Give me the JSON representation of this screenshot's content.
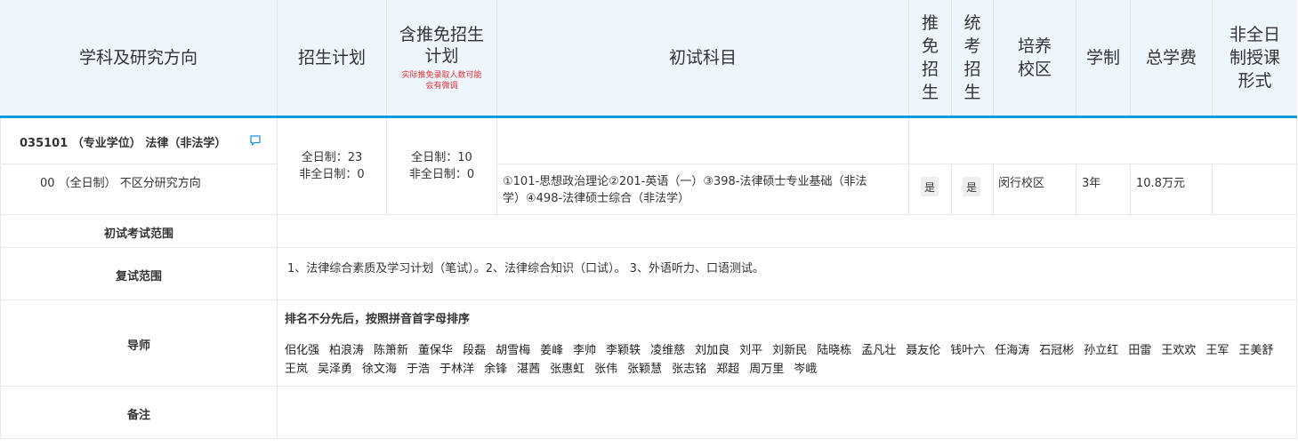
{
  "header": {
    "col_subject": "学科及研究方向",
    "col_plan": "招生计划",
    "col_exempt_line1": "含推免招生",
    "col_exempt_line2": "计划",
    "col_exempt_note_line1": "实际推免录取人数可能",
    "col_exempt_note_line2": "会有微调",
    "col_exam_subjects": "初试科目",
    "col_recommend": [
      "推",
      "免",
      "招",
      "生"
    ],
    "col_unified": [
      "统",
      "考",
      "招",
      "生"
    ],
    "col_campus": [
      "培养",
      "校区"
    ],
    "col_duration": "学制",
    "col_tuition": "总学费",
    "col_parttime": [
      "非全日",
      "制授课",
      "形式"
    ]
  },
  "program": {
    "code_title": "035101 （专业学位） 法律（非法学）",
    "direction": "00 （全日制） 不区分研究方向",
    "plan_full": "全日制：23",
    "plan_part": "非全日制：0",
    "exempt_full": "全日制：10",
    "exempt_part": "非全日制：0",
    "exam_line1": "①101-思想政治理论②201-英语（一）③398-法律硕士专业基础（非法",
    "exam_line2": "学）④498-法律硕士综合（非法学）",
    "recommend": "是",
    "unified": "是",
    "campus": "闵行校区",
    "duration": "3年",
    "tuition": "10.8万元"
  },
  "rows": {
    "initial_scope_label": "初试考试范围",
    "retest_label": "复试范围",
    "retest_text": "1、法律综合素质及学习计划（笔试）。2、法律综合知识（口试）。 3、外语听力、口语测试。",
    "tutor_label": "导师",
    "tutor_note": "排名不分先后，按照拼音首字母排序",
    "tutors": [
      "佀化强",
      "柏浪涛",
      "陈箫新",
      "董保华",
      "段磊",
      "胡雪梅",
      "姜峰",
      "李帅",
      "李颖轶",
      "凌维慈",
      "刘加良",
      "刘平",
      "刘新民",
      "陆晓栋",
      "孟凡壮",
      "聂友伦",
      "钱叶六",
      "任海涛",
      "石冠彬",
      "孙立红",
      "田雷",
      "王欢欢",
      "王军",
      "王美舒",
      "王岚",
      "吴泽勇",
      "徐文海",
      "于浩",
      "于林洋",
      "余锋",
      "湛茜",
      "张惠虹",
      "张伟",
      "张颖慧",
      "张志铭",
      "郑超",
      "周万里",
      "岑峨"
    ],
    "remark_label": "备注"
  },
  "colors": {
    "header_bg": "#eef5fd",
    "accent": "#0f9ae0",
    "note_red": "#e03030"
  }
}
